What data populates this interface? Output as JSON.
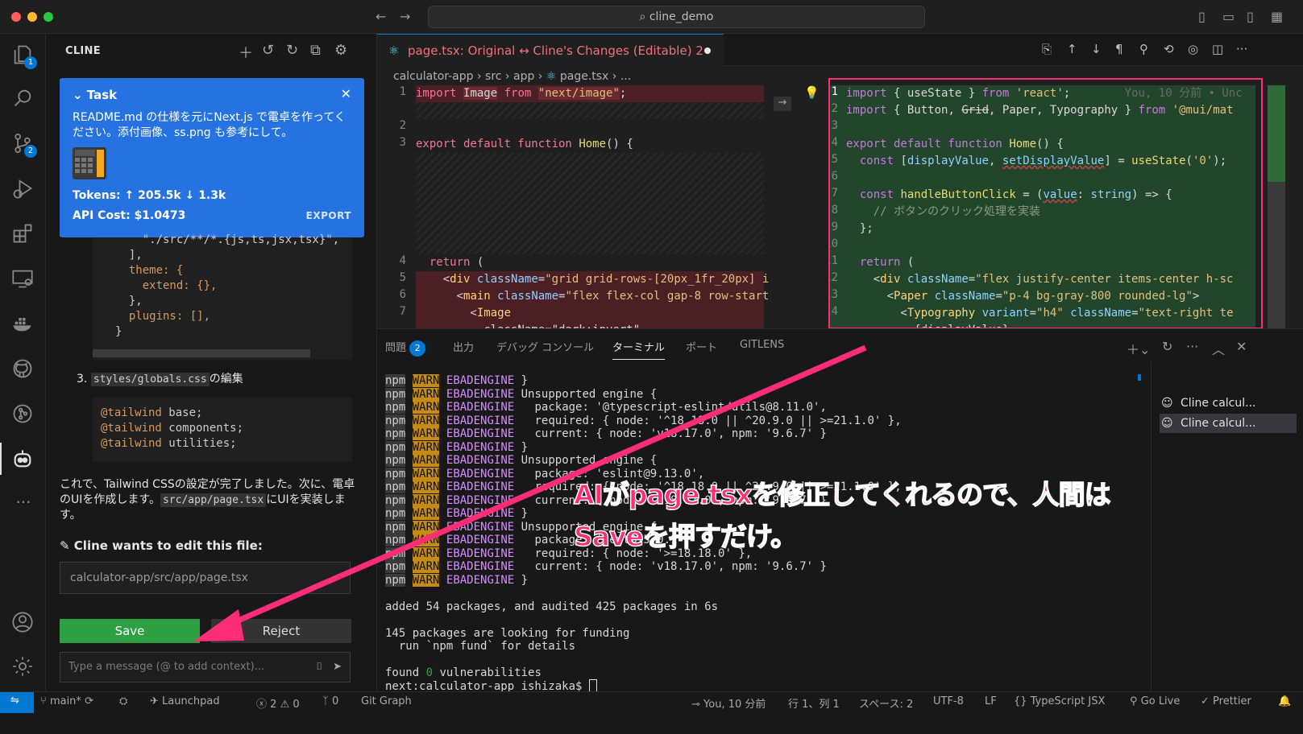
{
  "window": {
    "search_text": "cline_demo"
  },
  "activity_bar": {
    "explorer_badge": "1",
    "scm_badge": "2"
  },
  "cline": {
    "title": "CLINE",
    "task": {
      "header": "Task",
      "text": "README.md の仕様を元にNext.js で電卓を作ってください。添付画像、ss.png も参考にして。",
      "tokens": "Tokens: ↑ 205.5k ↓ 1.3k",
      "api_cost": "API Cost: $1.0473",
      "export_label": "EXPORT"
    },
    "config_code": [
      "    \"./src/**/*.{js,ts,jsx,tsx}\",",
      "  ],",
      "  theme: {",
      "    extend: {},",
      "  },",
      "  plugins: [],",
      "}"
    ],
    "step3_number": "3.",
    "step3_file": "styles/globals.css",
    "step3_suffix": "の編集",
    "tailwind_lines": [
      {
        "d": "@tailwind",
        "rest": " base;"
      },
      {
        "d": "@tailwind",
        "rest": " components;"
      },
      {
        "d": "@tailwind",
        "rest": " utilities;"
      }
    ],
    "para_text1": "これで、Tailwind CSSの設定が完了しました。次に、電卓のUIを作成します。",
    "para_code": "src/app/page.tsx",
    "para_text2": "にUIを実装します。",
    "wants_edit": "Cline wants to edit this file:",
    "file_path": "calculator-app/src/app/page.tsx",
    "save_label": "Save",
    "reject_label": "Reject",
    "message_placeholder": "Type a message (@ to add context)..."
  },
  "editor": {
    "tab_title": "page.tsx: Original ↔ Cline's Changes (Editable)",
    "tab_count": "2",
    "breadcrumb": [
      "calculator-app",
      "src",
      "app",
      "page.tsx",
      "..."
    ],
    "blame": "You, 10 分前 • Unc",
    "left_lines": [
      {
        "n": "1",
        "code": "import Image from \"next/image\";"
      },
      {
        "n": "2",
        "code": ""
      },
      {
        "n": "3",
        "code": "export default function Home() {"
      },
      {
        "n": "4",
        "code": "  return ("
      },
      {
        "n": "5",
        "code": "    <div className=\"grid grid-rows-[20px_1fr_20px] i"
      },
      {
        "n": "6",
        "code": "      <main className=\"flex flex-col gap-8 row-start"
      },
      {
        "n": "7",
        "code": "        <Image"
      },
      {
        "n": "",
        "code": "          className=\"dark:invert\""
      }
    ],
    "right_lines": [
      {
        "n": "1",
        "code": "import { useState } from 'react';"
      },
      {
        "n": "2",
        "code": "import { Button, Grid, Paper, Typography } from '@mui/mat"
      },
      {
        "n": "3",
        "code": ""
      },
      {
        "n": "4",
        "code": "export default function Home() {"
      },
      {
        "n": "5",
        "code": "  const [displayValue, setDisplayValue] = useState('0');"
      },
      {
        "n": "6",
        "code": ""
      },
      {
        "n": "7",
        "code": "  const handleButtonClick = (value: string) => {"
      },
      {
        "n": "8",
        "code": "    // ボタンのクリック処理を実装"
      },
      {
        "n": "9",
        "code": "  };"
      },
      {
        "n": "10",
        "code": ""
      },
      {
        "n": "11",
        "code": "  return ("
      },
      {
        "n": "12",
        "code": "    <div className=\"flex justify-center items-center h-sc"
      },
      {
        "n": "13",
        "code": "      <Paper className=\"p-4 bg-gray-800 rounded-lg\">"
      },
      {
        "n": "14",
        "code": "        <Typography variant=\"h4\" className=\"text-right te"
      },
      {
        "n": "",
        "code": "          {displayValue}"
      }
    ]
  },
  "panel": {
    "tabs": [
      "問題",
      "出力",
      "デバッグ コンソール",
      "ターミナル",
      "ポート",
      "GITLENS"
    ],
    "problems_badge": "2",
    "terminal_lines": [
      {
        "t": "w",
        "text": " }"
      },
      {
        "t": "w",
        "text": " Unsupported engine {"
      },
      {
        "t": "w",
        "text": "   package: '@typescript-eslint/utils@8.11.0',"
      },
      {
        "t": "w",
        "text": "   required: { node: '^18.18.0 || ^20.9.0 || >=21.1.0' },"
      },
      {
        "t": "w",
        "text": "   current: { node: 'v18.17.0', npm: '9.6.7' }"
      },
      {
        "t": "w",
        "text": " }"
      },
      {
        "t": "w",
        "text": " Unsupported engine {"
      },
      {
        "t": "w",
        "text": "   package: 'eslint@9.13.0',"
      },
      {
        "t": "w",
        "text": "   required: { node: '^18.18.0 || ^20.9.0 || >=21.1.0' },"
      },
      {
        "t": "w",
        "text": "   current: { node: 'v18.17.0', npm: '9.6.7' }"
      },
      {
        "t": "w",
        "text": " }"
      },
      {
        "t": "w",
        "text": " Unsupported engine {"
      },
      {
        "t": "w",
        "text": "   package: 'next@15.0.1',"
      },
      {
        "t": "w",
        "text": "   required: { node: '>=18.18.0' },"
      },
      {
        "t": "w",
        "text": "   current: { node: 'v18.17.0', npm: '9.6.7' }"
      },
      {
        "t": "w",
        "text": " }"
      },
      {
        "t": "p",
        "text": ""
      },
      {
        "t": "p",
        "text": "added 54 packages, and audited 425 packages in 6s"
      },
      {
        "t": "p",
        "text": ""
      },
      {
        "t": "p",
        "text": "145 packages are looking for funding"
      },
      {
        "t": "p",
        "text": "  run `npm fund` for details"
      },
      {
        "t": "p",
        "text": ""
      }
    ],
    "npm": "npm",
    "warn": "WARN",
    "ebad": "EBADENGINE",
    "found_prefix": "found ",
    "found_zero": "0",
    "found_suffix": " vulnerabilities",
    "prompt": "next:calculator-app ishizaka$ ",
    "terminal_list": [
      "Cline calcul...",
      "Cline calcul..."
    ]
  },
  "status": {
    "branch": "main*",
    "launchpad": "Launchpad",
    "errors": "2",
    "warnings": "0",
    "ports": "0",
    "git_graph": "Git Graph",
    "blame": "You, 10 分前",
    "position": "行 1、列 1",
    "spaces": "スペース: 2",
    "encoding": "UTF-8",
    "eol": "LF",
    "language": "TypeScript JSX",
    "golive": "Go Live",
    "prettier": "Prettier"
  },
  "annotation": {
    "line1": "AIがpage.tsxを修正してくれるので、人間は",
    "line2": "Saveを押すだけ。",
    "color": "#ff2d75"
  }
}
